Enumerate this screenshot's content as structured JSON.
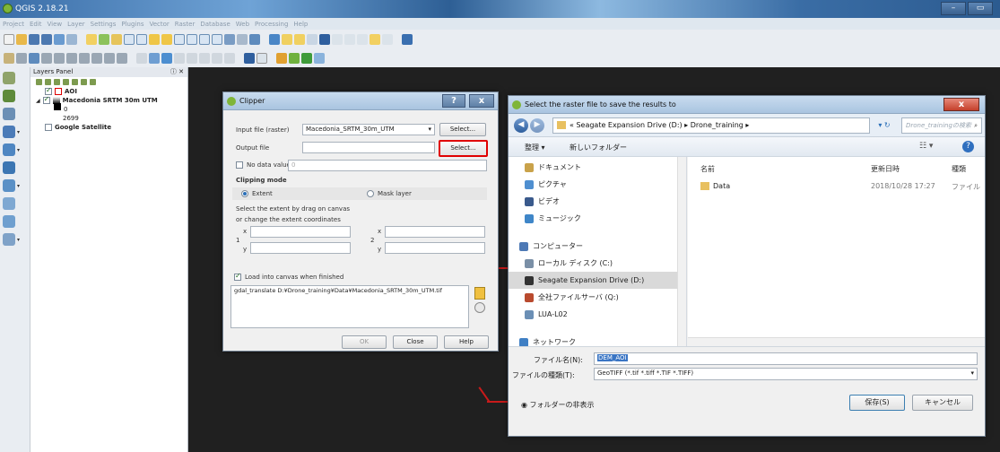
{
  "app": {
    "title": "QGIS 2.18.21"
  },
  "menu": [
    "Project",
    "Edit",
    "View",
    "Layer",
    "Settings",
    "Plugins",
    "Vector",
    "Raster",
    "Database",
    "Web",
    "Processing",
    "Help"
  ],
  "layers_panel": {
    "title": "Layers Panel",
    "items": [
      {
        "name": "AOI",
        "checked": true
      },
      {
        "name": "Macedonia SRTM 30m UTM",
        "checked": true
      },
      {
        "name": "0"
      },
      {
        "name": "2699"
      },
      {
        "name": "Google Satellite",
        "checked": false
      }
    ]
  },
  "clipper": {
    "title": "Clipper",
    "help_btn": "?",
    "close_btn": "x",
    "input_label": "Input file (raster)",
    "input_value": "Macedonia_SRTM_30m_UTM",
    "select_btn": "Select...",
    "output_label": "Output file",
    "output_select_btn": "Select...",
    "nodata_label": "No data value",
    "nodata_value": "0",
    "mode_heading": "Clipping mode",
    "extent_label": "Extent",
    "mask_label": "Mask layer",
    "hint1": "Select the extent by drag on canvas",
    "hint2": "or change the extent coordinates",
    "x": "x",
    "y": "y",
    "one": "1",
    "two": "2",
    "load_label": "Load into canvas when finished",
    "command": "gdal_translate D:¥Drone_training¥Data¥Macedonia_SRTM_30m_UTM.tif",
    "ok": "OK",
    "close": "Close",
    "help": "Help"
  },
  "save_dialog": {
    "title": "Select the raster file to save the results to",
    "close": "x",
    "breadcrumb": "« Seagate Expansion Drive (D:) ▸ Drone_training ▸",
    "search_placeholder": "Drone_trainingの検索",
    "organize": "整理 ▾",
    "new_folder": "新しいフォルダー",
    "nav": [
      {
        "label": "ドキュメント",
        "color": "#c9a24a"
      },
      {
        "label": "ピクチャ",
        "color": "#4f8fd0"
      },
      {
        "label": "ビデオ",
        "color": "#3a5a8c"
      },
      {
        "label": "ミュージック",
        "color": "#3f86c8"
      },
      {
        "label": "",
        "color": ""
      },
      {
        "label": "コンピューター",
        "color": "#4d79b5"
      },
      {
        "label": "ローカル ディスク (C:)",
        "color": "#7a8fa6"
      },
      {
        "label": "Seagate Expansion Drive (D:)",
        "color": "#333333"
      },
      {
        "label": "全社ファイルサーバ (Q:)",
        "color": "#b94a2e"
      },
      {
        "label": "LUA-L02",
        "color": "#6b8fb5"
      },
      {
        "label": "",
        "color": ""
      },
      {
        "label": "ネットワーク",
        "color": "#3f7fc4"
      }
    ],
    "columns": {
      "name": "名前",
      "date": "更新日時",
      "type": "種類"
    },
    "files": [
      {
        "name": "Data",
        "date": "2018/10/28 17:27",
        "type": "ファイル"
      }
    ],
    "filename_label": "ファイル名(N):",
    "filename_value": "DEM_AOI",
    "filetype_label": "ファイルの種類(T):",
    "filetype_value": "GeoTIFF (*.tif *.tiff *.TIF *.TIFF)",
    "hide_folders": "フォルダーの非表示",
    "save": "保存(S)",
    "cancel": "キャンセル"
  },
  "colors": {
    "highlight": "#e00000",
    "accent": "#3a6da5"
  }
}
